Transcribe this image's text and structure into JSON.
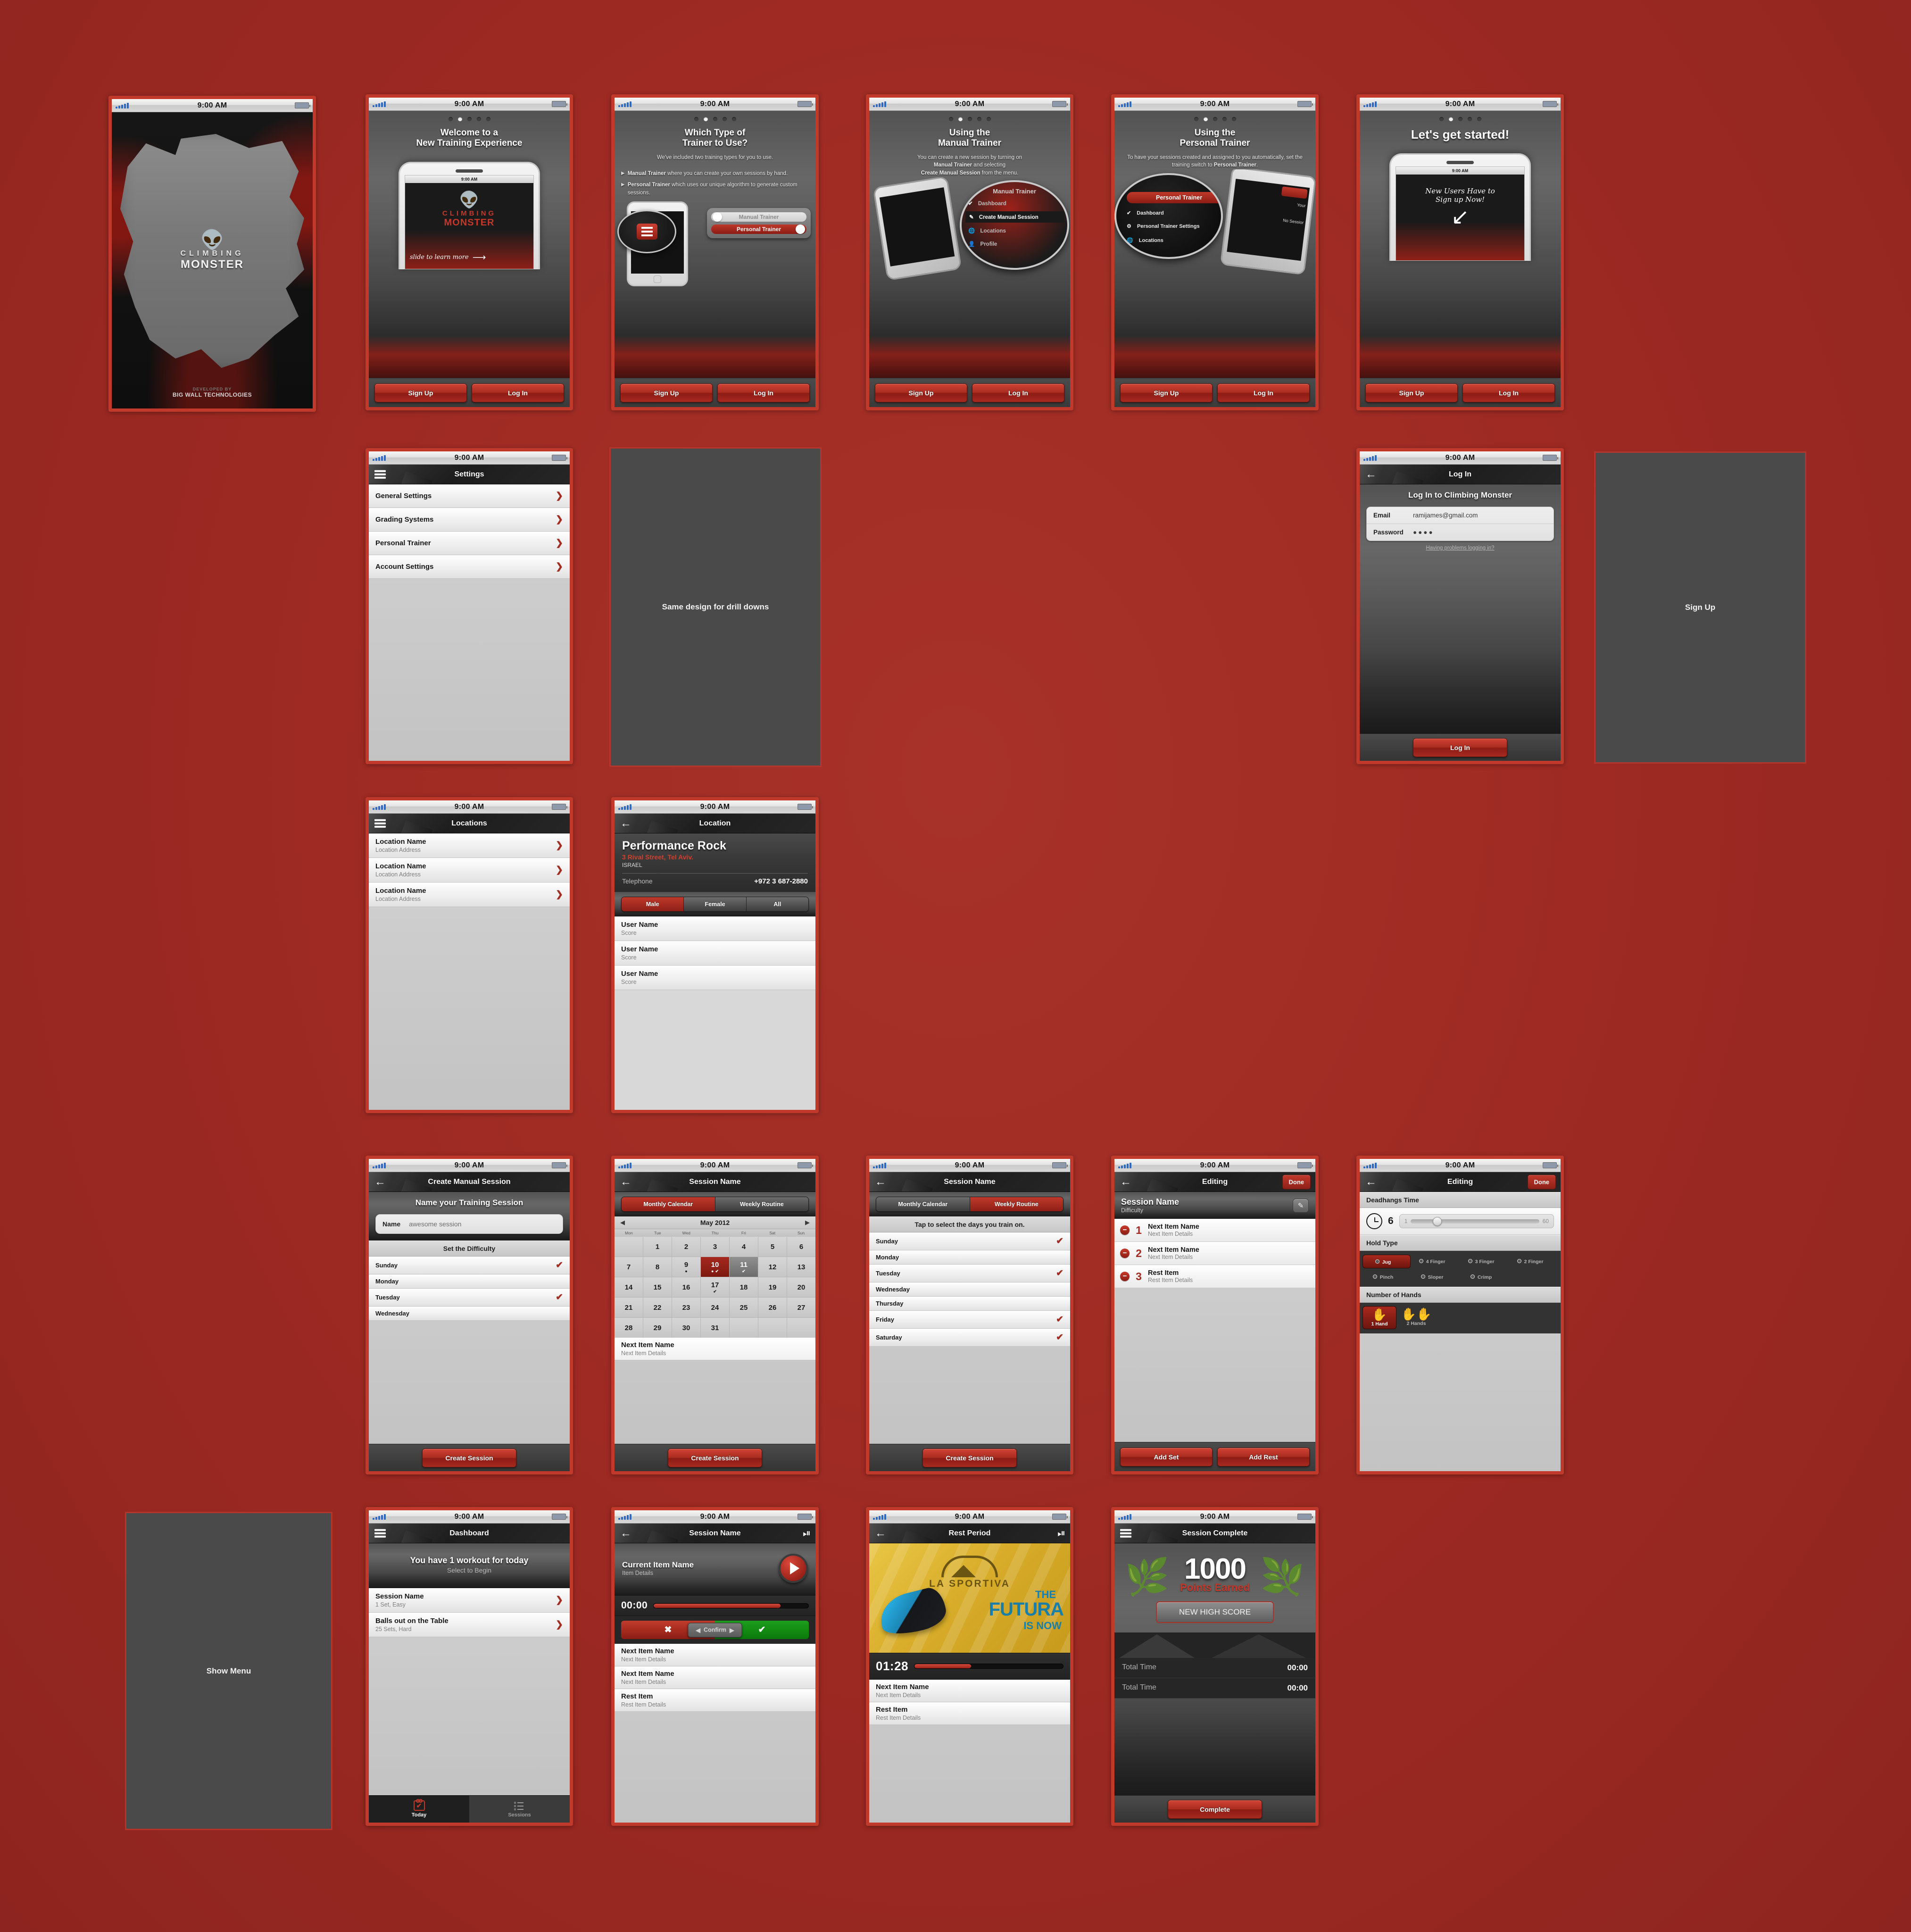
{
  "status_bar": {
    "time": "9:00 AM"
  },
  "splash": {
    "logo_line1": "CLIMBING",
    "logo_line2": "MONSTER",
    "credit_line1": "DEVELOPED BY",
    "credit_line2": "BIG WALL TECHNOLOGIES"
  },
  "onboarding": {
    "signup_label": "Sign Up",
    "login_label": "Log In",
    "slides": [
      {
        "title_line1": "Welcome to a",
        "title_line2": "New Training Experience",
        "body": "",
        "art_caption": "slide to learn more",
        "mock_logo1": "CLIMBING",
        "mock_logo2": "MONSTER"
      },
      {
        "title_line1": "Which Type of",
        "title_line2": "Trainer to Use?",
        "intro": "We've included two training types for you to use.",
        "bullets": [
          {
            "strong": "Manual Trainer",
            "rest": "where you can create your own sessions by hand."
          },
          {
            "strong": "Personal Trainer",
            "rest": "which uses our unique algorithm to generate custom sessions."
          }
        ],
        "switch_off": "Manual Trainer",
        "switch_on": "Personal Trainer"
      },
      {
        "title_line1": "Using the",
        "title_line2": "Manual Trainer",
        "body_1": "You can create a new session by turning on",
        "body_strong_1": "Manual Trainer",
        "body_2": "and selecting",
        "body_strong_2": "Create Manual Session",
        "body_3": "from the menu.",
        "menu_header": "Manual Trainer",
        "menu_items": [
          "Dashboard",
          "Create Manual Session",
          "Locations",
          "Profile"
        ]
      },
      {
        "title_line1": "Using the",
        "title_line2": "Personal Trainer",
        "body_1": "To have your sessions created and assigned to you automatically, set the training switch to",
        "body_strong_1": "Personal Trainer",
        "body_3": ".",
        "menu_toggle": "Personal Trainer",
        "menu_items": [
          "Dashboard",
          "Personal Trainer Settings",
          "Locations"
        ],
        "peek_text": "No Sessior"
      },
      {
        "title_line1": "Let's get started!",
        "art_caption_1": "New Users Have to",
        "art_caption_2": "Sign up Now!"
      }
    ]
  },
  "settings": {
    "title": "Settings",
    "items": [
      "General Settings",
      "Grading Systems",
      "Personal Trainer",
      "Account Settings"
    ]
  },
  "placeholders": {
    "drilldowns": "Same design for drill downs",
    "signup": "Sign Up",
    "show_menu": "Show Menu"
  },
  "login": {
    "nav_title": "Log In",
    "heading": "Log In to Climbing Monster",
    "email_label": "Email",
    "email_value": "ramijames@gmail.com",
    "password_label": "Password",
    "password_value": "●●●●",
    "help_link": "Having problems logging in?",
    "submit_label": "Log In"
  },
  "locations": {
    "title": "Locations",
    "rows": [
      {
        "name": "Location Name",
        "address": "Location Address"
      },
      {
        "name": "Location Name",
        "address": "Location Address"
      },
      {
        "name": "Location Name",
        "address": "Location Address"
      }
    ]
  },
  "location_detail": {
    "nav_title": "Location",
    "name": "Performance Rock",
    "address": "3 Rival Street, Tel Aviv.",
    "country": "ISRAEL",
    "telephone_label": "Telephone",
    "telephone_value": "+972 3 687-2880",
    "segments": [
      "Male",
      "Female",
      "All"
    ],
    "segment_selected": "Male",
    "users": [
      {
        "name": "User Name",
        "score": "Score"
      },
      {
        "name": "User Name",
        "score": "Score"
      },
      {
        "name": "User Name",
        "score": "Score"
      }
    ]
  },
  "create_session": {
    "nav_title": "Create Manual Session",
    "heading": "Name your Training Session",
    "name_label": "Name",
    "name_value": "awesome session",
    "difficulty_header": "Set the Difficulty",
    "days": [
      {
        "label": "Sunday",
        "checked": true
      },
      {
        "label": "Monday",
        "checked": false
      },
      {
        "label": "Tuesday",
        "checked": true
      },
      {
        "label": "Wednesday",
        "checked": false
      }
    ],
    "submit_label": "Create Session"
  },
  "calendar_screen": {
    "nav_title": "Session Name",
    "segments": [
      "Monthly Calendar",
      "Weekly Routine"
    ],
    "segment_selected": "Monthly Calendar",
    "month": "May 2012",
    "prev_icon": "◀",
    "next_icon": "▶",
    "dow": [
      "Mon",
      "Tue",
      "Wed",
      "Thu",
      "Fri",
      "Sat",
      "Sun"
    ],
    "weeks": [
      [
        {
          "d": ""
        },
        {
          "d": "1"
        },
        {
          "d": "2"
        },
        {
          "d": "3"
        },
        {
          "d": "4"
        },
        {
          "d": "5"
        },
        {
          "d": "6"
        }
      ],
      [
        {
          "d": "7"
        },
        {
          "d": "8"
        },
        {
          "d": "9",
          "dot": true
        },
        {
          "d": "10",
          "state": "sel",
          "dot": true,
          "check": true
        },
        {
          "d": "11",
          "state": "today",
          "check": true
        },
        {
          "d": "12"
        },
        {
          "d": "13"
        }
      ],
      [
        {
          "d": "14"
        },
        {
          "d": "15"
        },
        {
          "d": "16"
        },
        {
          "d": "17",
          "check": true
        },
        {
          "d": "18"
        },
        {
          "d": "19"
        },
        {
          "d": "20"
        }
      ],
      [
        {
          "d": "21"
        },
        {
          "d": "22"
        },
        {
          "d": "23"
        },
        {
          "d": "24"
        },
        {
          "d": "25"
        },
        {
          "d": "26"
        },
        {
          "d": "27"
        }
      ],
      [
        {
          "d": "28"
        },
        {
          "d": "29"
        },
        {
          "d": "30"
        },
        {
          "d": "31"
        },
        {
          "d": ""
        },
        {
          "d": ""
        },
        {
          "d": ""
        }
      ]
    ],
    "next_item_name": "Next Item Name",
    "next_item_details": "Next Item Details",
    "submit_label": "Create Session"
  },
  "weekly_routine": {
    "nav_title": "Session Name",
    "segments": [
      "Monthly Calendar",
      "Weekly Routine"
    ],
    "segment_selected": "Weekly Routine",
    "hint": "Tap to select the days you train on.",
    "days": [
      {
        "label": "Sunday",
        "checked": true
      },
      {
        "label": "Monday",
        "checked": false
      },
      {
        "label": "Tuesday",
        "checked": true
      },
      {
        "label": "Wednesday",
        "checked": false
      },
      {
        "label": "Thursday",
        "checked": false
      },
      {
        "label": "Friday",
        "checked": true
      },
      {
        "label": "Saturday",
        "checked": true
      }
    ],
    "submit_label": "Create Session"
  },
  "editing_list": {
    "nav_title": "Editing",
    "done_label": "Done",
    "session_name": "Session Name",
    "difficulty": "Difficulty",
    "items": [
      {
        "index": "1",
        "name": "Next Item Name",
        "details": "Next Item Details"
      },
      {
        "index": "2",
        "name": "Next Item Name",
        "details": "Next Item Details"
      },
      {
        "index": "3",
        "name": "Rest Item",
        "details": "Rest Item Details"
      }
    ],
    "add_set_label": "Add Set",
    "add_rest_label": "Add Rest"
  },
  "editing_deadhangs": {
    "nav_title": "Editing",
    "done_label": "Done",
    "time_header": "Deadhangs Time",
    "time_value": "6",
    "slider_min": "1",
    "slider_max": "60",
    "hold_header": "Hold Type",
    "holds": [
      {
        "label": "Jug",
        "selected": true
      },
      {
        "label": "4 Finger",
        "selected": false
      },
      {
        "label": "3 Finger",
        "selected": false
      },
      {
        "label": "2 Finger",
        "selected": false
      },
      {
        "label": "Pinch",
        "selected": false
      },
      {
        "label": "Sloper",
        "selected": false
      },
      {
        "label": "Crimp",
        "selected": false
      }
    ],
    "hands_header": "Number of Hands",
    "hands": [
      {
        "label": "1 Hand",
        "glyph": "✋",
        "selected": true
      },
      {
        "label": "2 Hands",
        "glyph": "✋✋",
        "selected": false
      }
    ]
  },
  "dashboard": {
    "nav_title": "Dashboard",
    "headline": "You have 1 workout for today",
    "subline": "Select to Begin",
    "sessions": [
      {
        "name": "Session Name",
        "details": "1 Set, Easy"
      },
      {
        "name": "Balls out on the Table",
        "details": "25 Sets, Hard"
      }
    ],
    "tabs": [
      {
        "label": "Today",
        "selected": true
      },
      {
        "label": "Sessions",
        "selected": false
      }
    ]
  },
  "player": {
    "nav_title": "Session Name",
    "current_name": "Current Item Name",
    "current_details": "Item Details",
    "timer": "00:00",
    "progress_percent": 82,
    "confirm_label": "Confirm",
    "queue": [
      {
        "name": "Next Item Name",
        "details": "Next Item Details"
      },
      {
        "name": "Next Item Name",
        "details": "Next Item Details"
      },
      {
        "name": "Rest Item",
        "details": "Rest Item Details"
      }
    ]
  },
  "rest_period": {
    "nav_title": "Rest Period",
    "ad_brand": "LA SPORTIVA",
    "ad_line1": "THE",
    "ad_line2": "FUTURA",
    "ad_line3": "IS NOW",
    "timer": "01:28",
    "progress_percent": 38,
    "queue": [
      {
        "name": "Next Item Name",
        "details": "Next Item Details"
      },
      {
        "name": "Rest Item",
        "details": "Rest Item Details"
      }
    ]
  },
  "session_complete": {
    "nav_title": "Session Complete",
    "points": "1000",
    "points_label": "Points Earned",
    "high_score_label": "NEW HIGH SCORE",
    "totals": [
      {
        "label": "Total Time",
        "value": "00:00"
      },
      {
        "label": "Total Time",
        "value": "00:00"
      }
    ],
    "submit_label": "Complete"
  }
}
